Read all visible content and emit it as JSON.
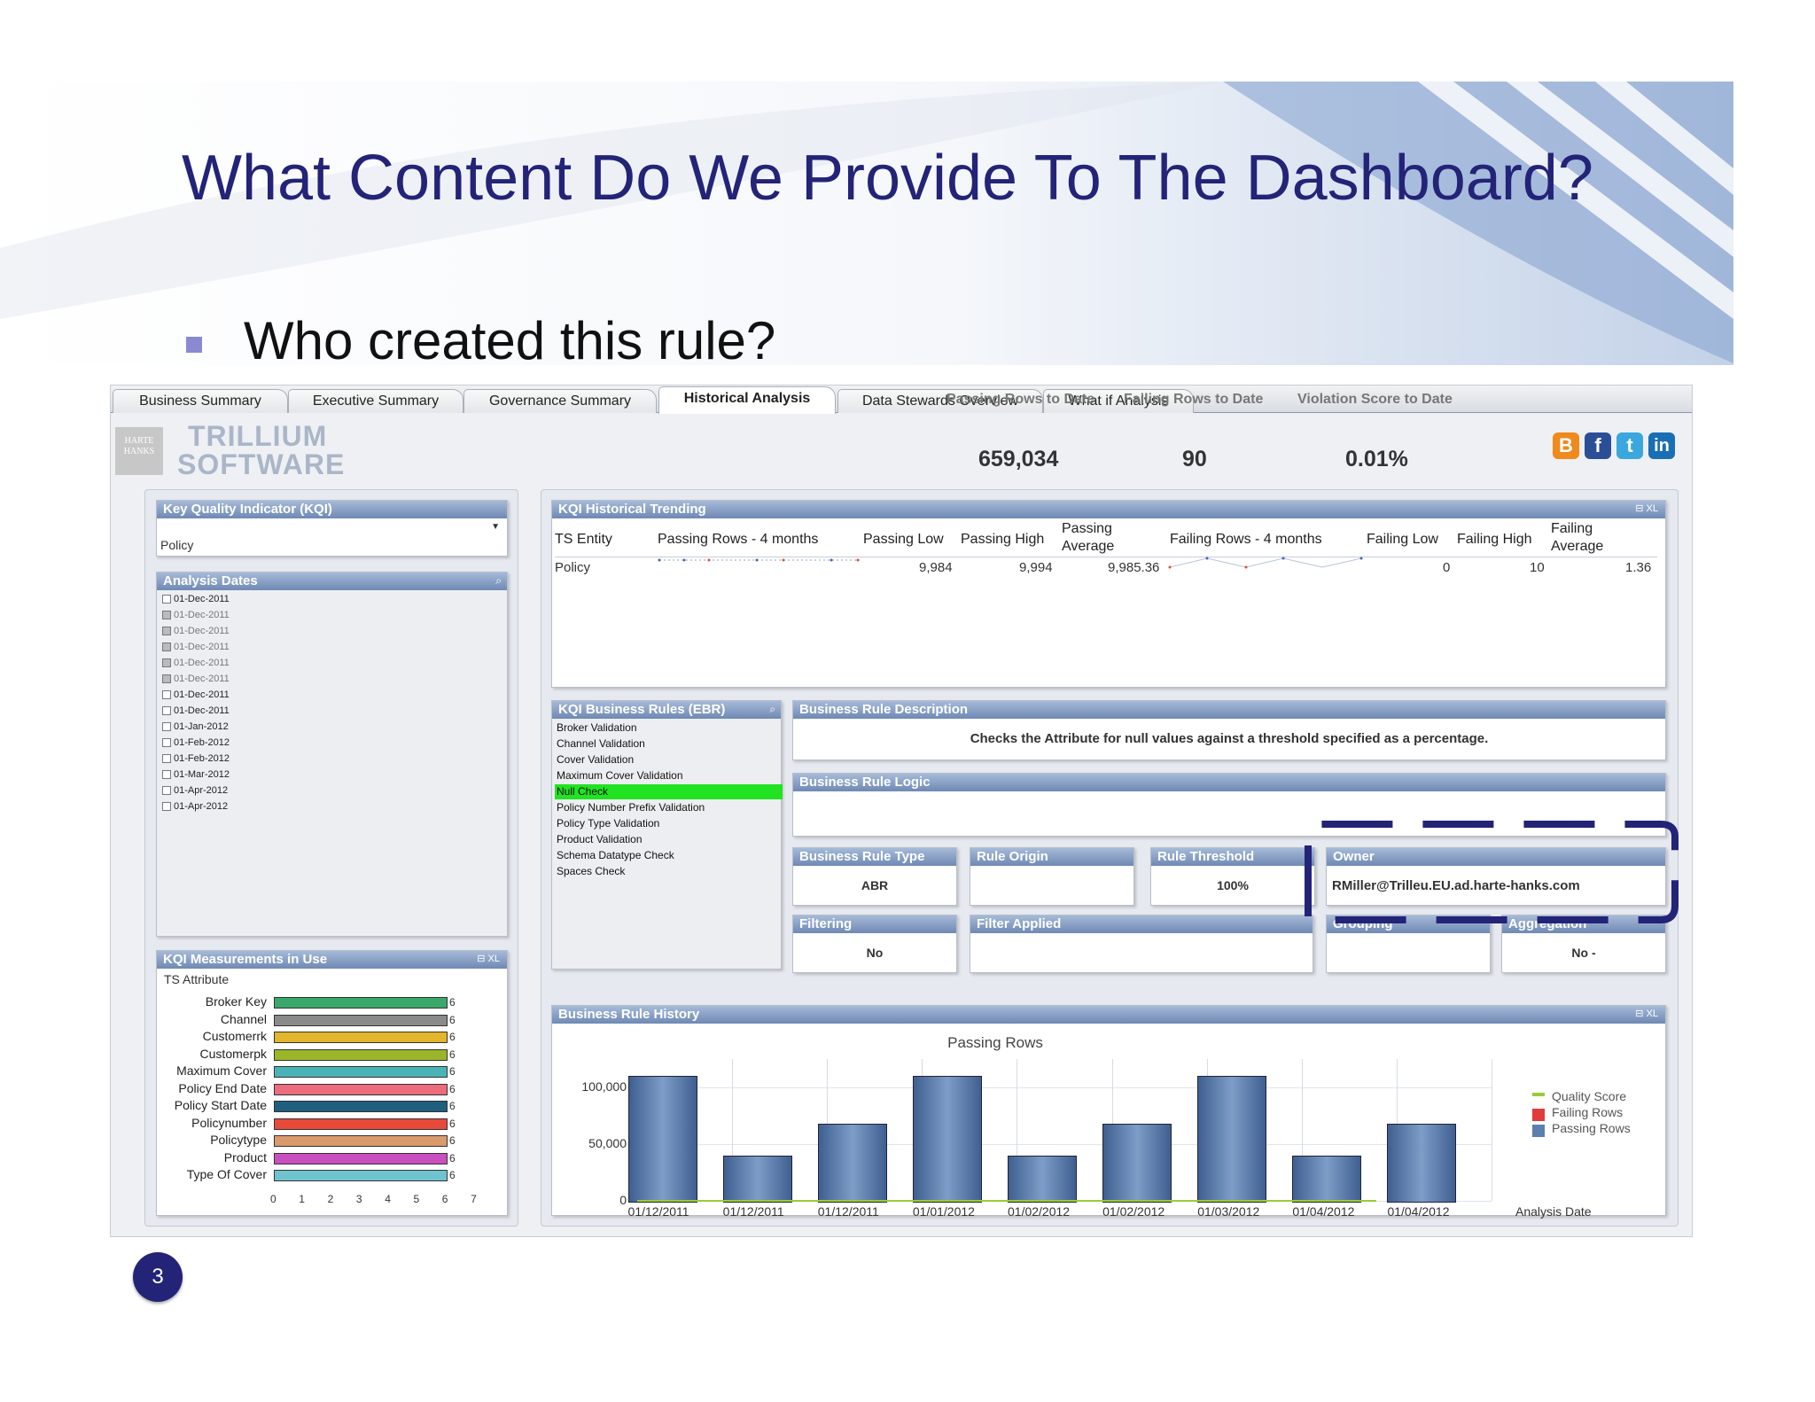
{
  "slide": {
    "title": "What Content Do We Provide To The Dashboard?",
    "bullet": "Who created this rule?",
    "page_number": "3"
  },
  "tabs": [
    {
      "label": "Business Summary"
    },
    {
      "label": "Executive Summary"
    },
    {
      "label": "Governance Summary"
    },
    {
      "label": "Historical Analysis",
      "active": true
    },
    {
      "label": "Data Stewards Overview"
    },
    {
      "label": "What if Analysis"
    }
  ],
  "logo": {
    "line1": "TRILLIUM",
    "line2": "SOFTWARE",
    "mark": "HARTE HANKS"
  },
  "header_stats": [
    {
      "label": "Passing Rows to Date",
      "value": "659,034"
    },
    {
      "label": "Failing Rows to Date",
      "value": "90"
    },
    {
      "label": "Violation Score to Date",
      "value": "0.01%"
    }
  ],
  "social_icons": [
    "blogger-icon",
    "facebook-icon",
    "twitter-icon",
    "linkedin-icon"
  ],
  "kqi_selector": {
    "title": "Key Quality Indicator (KQI)",
    "value": "Policy"
  },
  "analysis_dates": {
    "title": "Analysis Dates",
    "items": [
      {
        "label": "01-Dec-2011",
        "state": "normal"
      },
      {
        "label": "01-Dec-2011",
        "state": "dim"
      },
      {
        "label": "01-Dec-2011",
        "state": "dim"
      },
      {
        "label": "01-Dec-2011",
        "state": "dim"
      },
      {
        "label": "01-Dec-2011",
        "state": "dim"
      },
      {
        "label": "01-Dec-2011",
        "state": "dim"
      },
      {
        "label": "01-Dec-2011",
        "state": "normal"
      },
      {
        "label": "01-Dec-2011",
        "state": "normal"
      },
      {
        "label": "01-Jan-2012",
        "state": "normal"
      },
      {
        "label": "01-Feb-2012",
        "state": "normal"
      },
      {
        "label": "01-Feb-2012",
        "state": "normal"
      },
      {
        "label": "01-Mar-2012",
        "state": "normal"
      },
      {
        "label": "01-Apr-2012",
        "state": "normal"
      },
      {
        "label": "01-Apr-2012",
        "state": "normal"
      }
    ]
  },
  "measurements": {
    "title": "KQI Measurements in Use",
    "subtitle": "TS Attribute",
    "axis_ticks": [
      "0",
      "1",
      "2",
      "3",
      "4",
      "5",
      "6",
      "7"
    ],
    "axis_max": 7,
    "items": [
      {
        "label": "Broker Key",
        "value": 6,
        "color": "#3aa86b"
      },
      {
        "label": "Channel",
        "value": 6,
        "color": "#8a8a8a"
      },
      {
        "label": "Customerrk",
        "value": 6,
        "color": "#e2b52a"
      },
      {
        "label": "Customerpk",
        "value": 6,
        "color": "#9bb52a"
      },
      {
        "label": "Maximum Cover",
        "value": 6,
        "color": "#49b3b8"
      },
      {
        "label": "Policy End Date",
        "value": 6,
        "color": "#ec6b7c"
      },
      {
        "label": "Policy Start Date",
        "value": 6,
        "color": "#1e5f7d"
      },
      {
        "label": "Policynumber",
        "value": 6,
        "color": "#e84a3a"
      },
      {
        "label": "Policytype",
        "value": 6,
        "color": "#d99a6c"
      },
      {
        "label": "Product",
        "value": 6,
        "color": "#c94fbf"
      },
      {
        "label": "Type Of Cover",
        "value": 6,
        "color": "#6ec3cf"
      }
    ]
  },
  "kqi_trending": {
    "title": "KQI Historical Trending",
    "headers": {
      "entity": "TS Entity",
      "passing_rows": "Passing Rows - 4 months",
      "passing_low": "Passing Low",
      "passing_high": "Passing High",
      "passing_avg_1": "Passing",
      "passing_avg_2": "Average",
      "failing_rows": "Failing Rows - 4 months",
      "failing_low": "Failing Low",
      "failing_high": "Failing High",
      "failing_avg_1": "Failing",
      "failing_avg_2": "Average"
    },
    "row": {
      "entity": "Policy",
      "passing_low": "9,984",
      "passing_high": "9,994",
      "passing_avg": "9,985.36",
      "failing_low": "0",
      "failing_high": "10",
      "failing_avg": "1.36"
    }
  },
  "business_rules": {
    "title": "KQI Business Rules (EBR)",
    "items": [
      {
        "label": "Broker Validation"
      },
      {
        "label": "Channel Validation"
      },
      {
        "label": "Cover Validation"
      },
      {
        "label": "Maximum Cover Validation"
      },
      {
        "label": "Null Check",
        "selected": true
      },
      {
        "label": "Policy Number Prefix Validation"
      },
      {
        "label": "Policy Type Validation"
      },
      {
        "label": "Product Validation"
      },
      {
        "label": "Schema Datatype Check"
      },
      {
        "label": "Spaces Check"
      }
    ]
  },
  "rule_description": {
    "title": "Business Rule Description",
    "text": "Checks the Attribute for null values against a threshold specified as a percentage."
  },
  "rule_logic": {
    "title": "Business Rule Logic"
  },
  "rule_type": {
    "title": "Business Rule Type",
    "value": "ABR"
  },
  "rule_origin": {
    "title": "Rule Origin",
    "value": ""
  },
  "rule_threshold": {
    "title": "Rule Threshold",
    "value": "100%"
  },
  "owner": {
    "title": "Owner",
    "value": "RMiller@Trilleu.EU.ad.harte-hanks.com"
  },
  "filtering": {
    "title": "Filtering",
    "value": "No"
  },
  "filter_applied": {
    "title": "Filter Applied",
    "value": ""
  },
  "grouping": {
    "title": "Grouping",
    "value": ""
  },
  "aggregation": {
    "title": "Aggregation",
    "value": "No -"
  },
  "rule_history": {
    "title": "Business Rule History"
  },
  "chart_data": {
    "type": "bar",
    "title": "Passing Rows",
    "xlabel": "Analysis Date",
    "ylabel": "",
    "categories": [
      "01/12/2011",
      "01/12/2011",
      "01/12/2011",
      "01/01/2012",
      "01/02/2012",
      "01/02/2012",
      "01/03/2012",
      "01/04/2012",
      "01/04/2012"
    ],
    "series": [
      {
        "name": "Passing Rows",
        "values": [
          110000,
          40000,
          68000,
          110000,
          40000,
          68000,
          110000,
          40000,
          68000
        ],
        "color": "#5d7fad"
      },
      {
        "name": "Failing Rows",
        "values": [
          0,
          0,
          0,
          0,
          0,
          0,
          0,
          0,
          0
        ],
        "color": "#e23b3b"
      },
      {
        "name": "Quality Score",
        "values": [
          0,
          0,
          0,
          0,
          0,
          0,
          0,
          0,
          0
        ],
        "color": "#9acd32"
      }
    ],
    "y_ticks": [
      "0",
      "50,000",
      "100,000"
    ],
    "ylim": [
      0,
      125000
    ],
    "legend_position": "right"
  },
  "colors": {
    "title": "#232378",
    "panel_header": "#7b93bd",
    "highlight_dashed": "#232378",
    "selected_rule": "#22e322"
  }
}
